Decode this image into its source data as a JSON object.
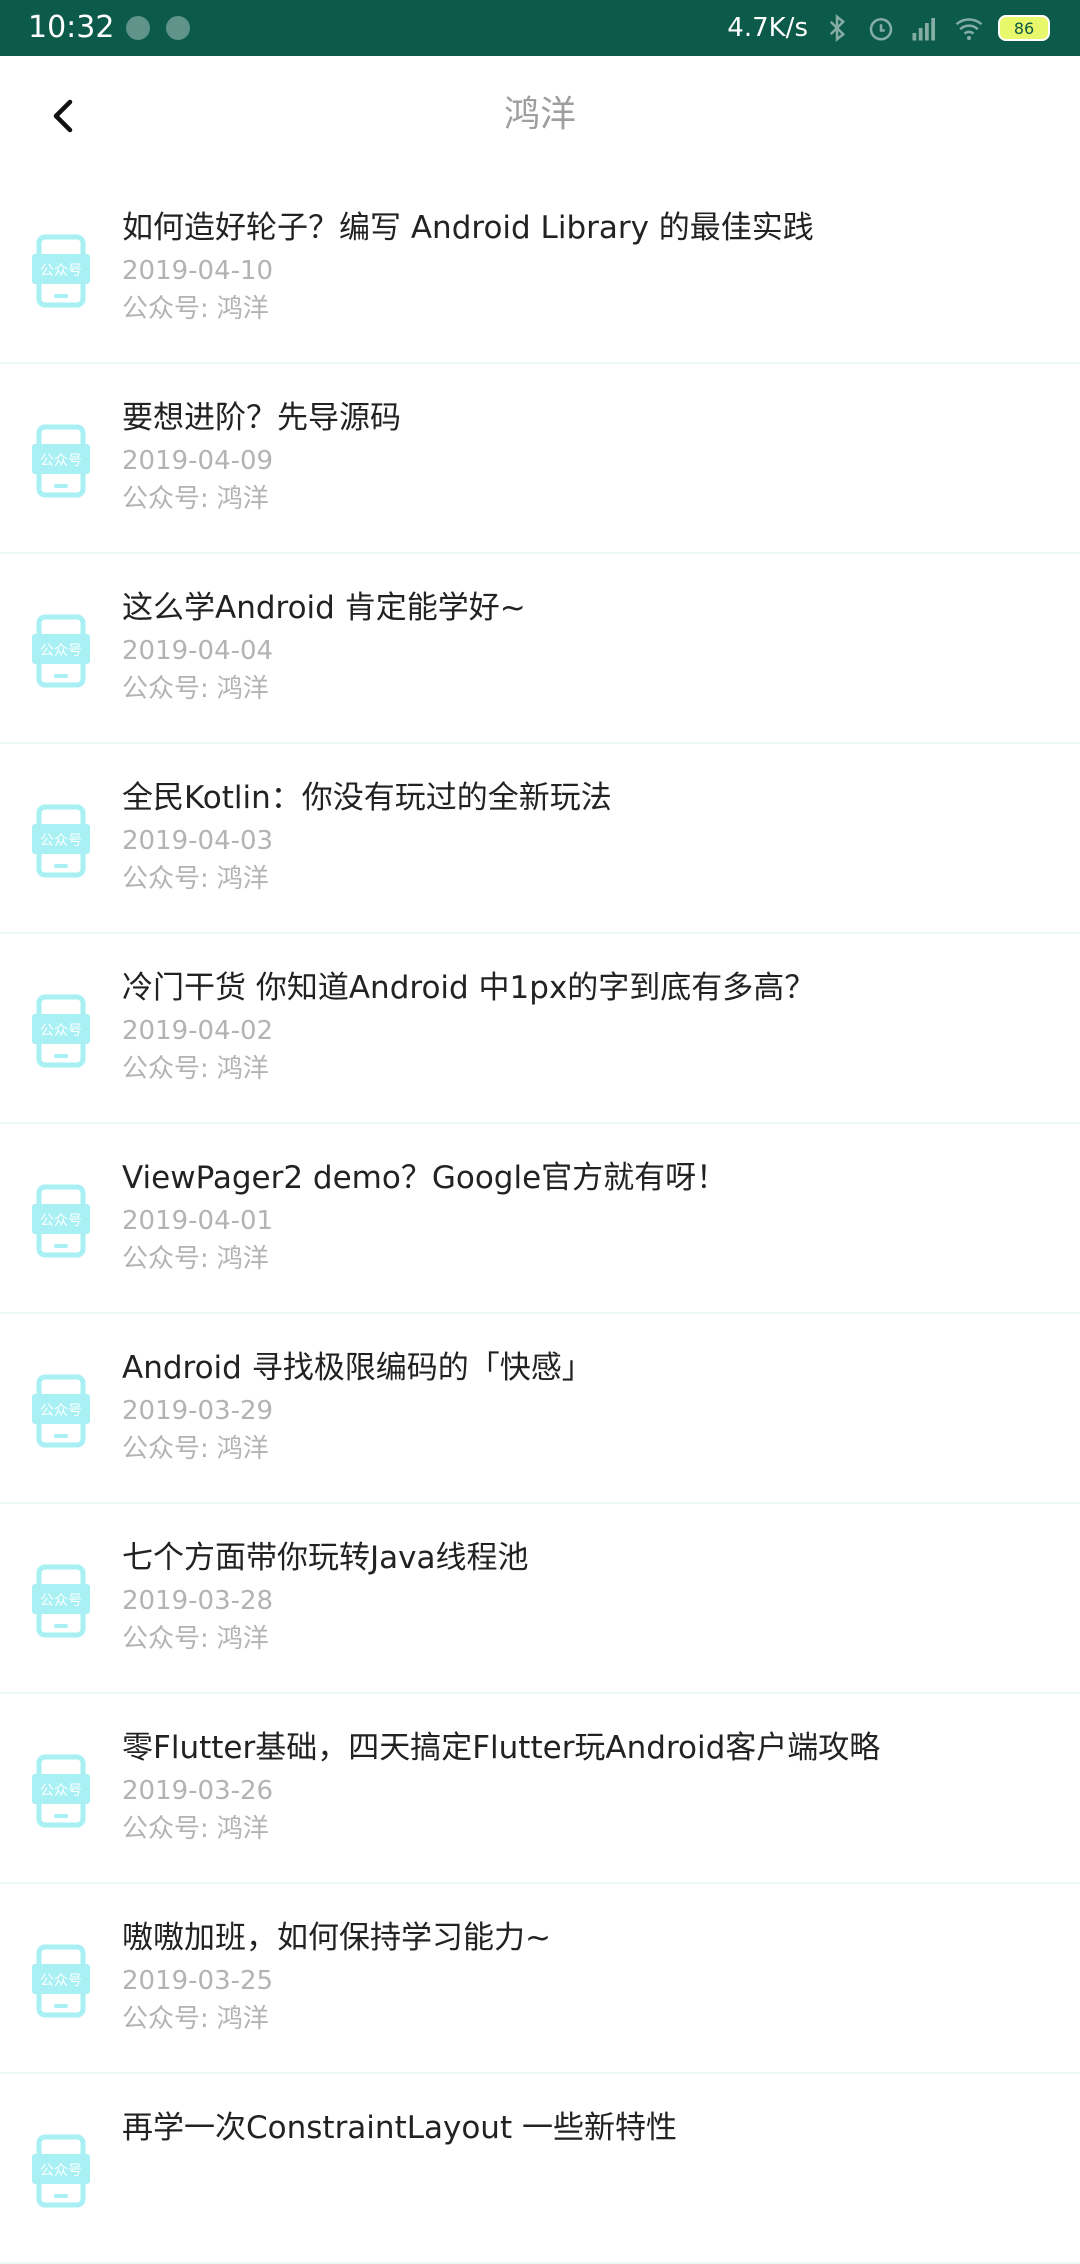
{
  "status_bar": {
    "time": "10:32",
    "speed": "4.7K/s",
    "battery": "86",
    "background_color": "#0b5a4a"
  },
  "app_bar": {
    "title": "鸿洋",
    "back_icon": "back-arrow-icon"
  },
  "article_icon": {
    "name": "wechat-official-account-icon",
    "label": "公众号",
    "color": "#a8f0f4"
  },
  "articles": [
    {
      "title": "如何造好轮子？编写 Android Library 的最佳实践",
      "date": "2019-04-10",
      "author_prefix": "公众号:",
      "author": "鸿洋"
    },
    {
      "title": "要想进阶？先导源码",
      "date": "2019-04-09",
      "author_prefix": "公众号:",
      "author": "鸿洋"
    },
    {
      "title": "这么学Android 肯定能学好~",
      "date": "2019-04-04",
      "author_prefix": "公众号:",
      "author": "鸿洋"
    },
    {
      "title": "全民Kotlin：你没有玩过的全新玩法",
      "date": "2019-04-03",
      "author_prefix": "公众号:",
      "author": "鸿洋"
    },
    {
      "title": "冷门干货 你知道Android 中1px的字到底有多高？",
      "date": "2019-04-02",
      "author_prefix": "公众号:",
      "author": "鸿洋"
    },
    {
      "title": "ViewPager2 demo？Google官方就有呀！",
      "date": "2019-04-01",
      "author_prefix": "公众号:",
      "author": "鸿洋"
    },
    {
      "title": "Android 寻找极限编码的「快感」",
      "date": "2019-03-29",
      "author_prefix": "公众号:",
      "author": "鸿洋"
    },
    {
      "title": "七个方面带你玩转Java线程池",
      "date": "2019-03-28",
      "author_prefix": "公众号:",
      "author": "鸿洋"
    },
    {
      "title": "零Flutter基础，四天搞定Flutter玩Android客户端攻略",
      "date": "2019-03-26",
      "author_prefix": "公众号:",
      "author": "鸿洋"
    },
    {
      "title": "嗷嗷加班，如何保持学习能力~",
      "date": "2019-03-25",
      "author_prefix": "公众号:",
      "author": "鸿洋"
    },
    {
      "title": "再学一次ConstraintLayout 一些新特性",
      "date": "",
      "author_prefix": "",
      "author": ""
    }
  ]
}
